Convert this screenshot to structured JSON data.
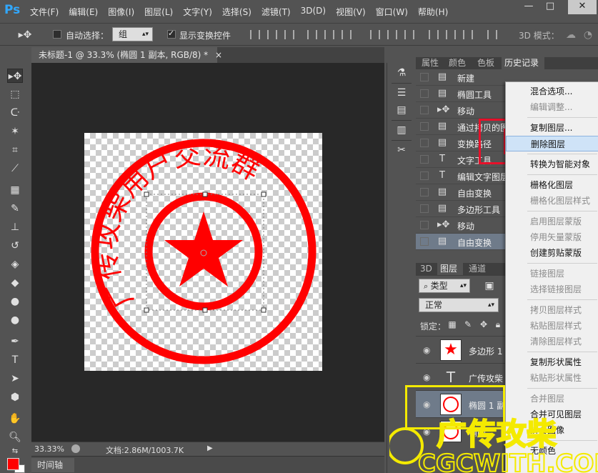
{
  "app": {
    "logo": "Ps",
    "window_buttons": [
      "—",
      "□",
      "✕"
    ]
  },
  "menu": [
    "文件(F)",
    "编辑(E)",
    "图像(I)",
    "图层(L)",
    "文字(Y)",
    "选择(S)",
    "滤镜(T)",
    "3D(D)",
    "视图(V)",
    "窗口(W)",
    "帮助(H)"
  ],
  "options": {
    "auto_select_label": "自动选择：",
    "auto_select_value": "组",
    "show_transform_label": "显示变换控件",
    "mode_3d_label": "3D 模式："
  },
  "document": {
    "tab_title": "未标题-1 @ 33.3% (椭圆 1 副本, RGB/8) *",
    "tab_close": "×",
    "zoom": "33.33%",
    "doc_info": "文档:2.86M/1003.7K",
    "timeline_tab": "时间轴"
  },
  "stamp": {
    "top_text": "广传攻柴用户交流群",
    "color": "#ff0000"
  },
  "panel_tabs_top": [
    "属性",
    "颜色",
    "色板",
    "历史记录"
  ],
  "history": [
    {
      "icon": "document-icon",
      "label": "新建"
    },
    {
      "icon": "document-icon",
      "label": "椭圆工具"
    },
    {
      "icon": "move-icon",
      "label": "移动"
    },
    {
      "icon": "document-icon",
      "label": "通过拷贝的图层"
    },
    {
      "icon": "document-icon",
      "label": "变换路径"
    },
    {
      "icon": "text-icon",
      "label": "文字工具"
    },
    {
      "icon": "text-icon",
      "label": "编辑文字图层"
    },
    {
      "icon": "document-icon",
      "label": "自由变换"
    },
    {
      "icon": "document-icon",
      "label": "多边形工具"
    },
    {
      "icon": "move-icon",
      "label": "移动"
    },
    {
      "icon": "document-icon",
      "label": "自由变换"
    }
  ],
  "panel_tabs_layers": [
    "3D",
    "图层",
    "通道"
  ],
  "layers_panel": {
    "filter_label": "类型",
    "blend_mode": "正常",
    "lock_label": "锁定：",
    "layers": [
      {
        "name": "多边形 1",
        "visible_icon": "eye-icon"
      },
      {
        "name": "广传攻柴",
        "visible_icon": "eye-icon"
      },
      {
        "name": "椭圆 1 副",
        "visible_icon": "eye-icon"
      },
      {
        "name": "椭圆",
        "visible_icon": "eye-icon"
      }
    ]
  },
  "context_menu": [
    {
      "label": "混合选项...",
      "enabled": true
    },
    {
      "label": "编辑调整...",
      "enabled": false
    },
    {
      "sep": true
    },
    {
      "label": "复制图层...",
      "enabled": true
    },
    {
      "label": "删除图层",
      "enabled": true,
      "highlight": true
    },
    {
      "sep": true
    },
    {
      "label": "转换为智能对象",
      "enabled": true
    },
    {
      "sep": true
    },
    {
      "label": "栅格化图层",
      "enabled": true
    },
    {
      "label": "栅格化图层样式",
      "enabled": false
    },
    {
      "sep": true
    },
    {
      "label": "启用图层蒙版",
      "enabled": false
    },
    {
      "label": "停用矢量蒙版",
      "enabled": false
    },
    {
      "label": "创建剪贴蒙版",
      "enabled": true
    },
    {
      "sep": true
    },
    {
      "label": "链接图层",
      "enabled": false
    },
    {
      "label": "选择链接图层",
      "enabled": false
    },
    {
      "sep": true
    },
    {
      "label": "拷贝图层样式",
      "enabled": false
    },
    {
      "label": "粘贴图层样式",
      "enabled": false
    },
    {
      "label": "清除图层样式",
      "enabled": false
    },
    {
      "sep": true
    },
    {
      "label": "复制形状属性",
      "enabled": true
    },
    {
      "label": "粘贴形状属性",
      "enabled": false
    },
    {
      "sep": true
    },
    {
      "label": "合并图层",
      "enabled": false
    },
    {
      "label": "合并可见图层",
      "enabled": true
    },
    {
      "label": "拼合图像",
      "enabled": true
    },
    {
      "sep": true
    },
    {
      "label": "无颜色",
      "enabled": true
    }
  ],
  "watermark": {
    "line1": "广传攻柴",
    "line2": "CGCWITH.COM",
    "color": "#f4ea00"
  }
}
